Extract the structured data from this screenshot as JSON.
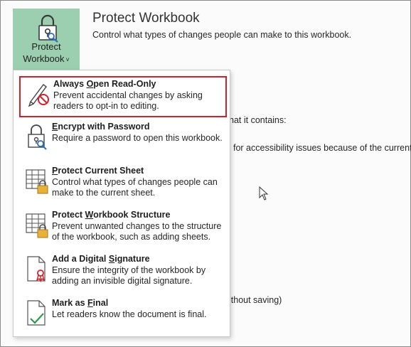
{
  "protect_workbook_button": {
    "line1": "Protect",
    "line2": "Workbook",
    "chevron": "˅",
    "icon": "lock-key-icon",
    "color": "#9bcfb0"
  },
  "section": {
    "title": "Protect Workbook",
    "description": "Control what types of changes people can make to this workbook."
  },
  "background_fragments": [
    "hat it contains:",
    "for accessibility issues because of the current",
    "ithout saving)"
  ],
  "menu": {
    "items": [
      {
        "title_pre": "Always ",
        "title_u": "O",
        "title_post": "pen Read-Only",
        "desc": "Prevent accidental changes by asking readers to opt-in to editing.",
        "icon": "pencil-prohibited-icon",
        "selected": true
      },
      {
        "title_pre": "",
        "title_u": "E",
        "title_post": "ncrypt with Password",
        "desc": "Require a password to open this workbook.",
        "icon": "lock-search-icon"
      },
      {
        "title_pre": "",
        "title_u": "P",
        "title_post": "rotect Current Sheet",
        "desc": "Control what types of changes people can make to the current sheet.",
        "icon": "sheet-lock-icon"
      },
      {
        "title_pre": "Protect ",
        "title_u": "W",
        "title_post": "orkbook Structure",
        "desc": "Prevent unwanted changes to the structure of the workbook, such as adding sheets.",
        "icon": "workbook-lock-icon"
      },
      {
        "title_pre": "Add a Digital ",
        "title_u": "S",
        "title_post": "ignature",
        "desc": "Ensure the integrity of the workbook by adding an invisible digital signature.",
        "icon": "ribbon-document-icon"
      },
      {
        "title_pre": "Mark as ",
        "title_u": "F",
        "title_post": "inal",
        "desc": "Let readers know the document is final.",
        "icon": "document-check-icon"
      }
    ]
  },
  "colors": {
    "selection_border": "#d0222c",
    "accent_green": "#9bcfb0",
    "lock_gold": "#e8b23a",
    "prohibit_red": "#d0222c"
  }
}
